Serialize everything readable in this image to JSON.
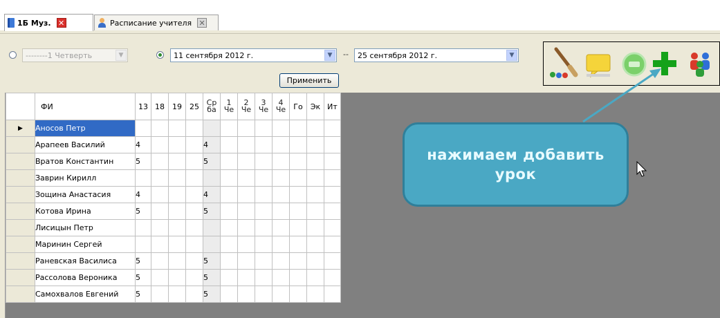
{
  "tabs": [
    {
      "label": "1Б Муз.",
      "active": true,
      "icon": "book-icon",
      "close": "close-red-icon"
    },
    {
      "label": "Расписание учителя",
      "active": false,
      "icon": "person-icon",
      "close": "close-grey-icon"
    }
  ],
  "filter": {
    "quarter_value": "--------1 Четверть",
    "date_from": "11 сентября 2012 г.",
    "date_sep": "--",
    "date_to": "25 сентября 2012 г.",
    "apply_label": "Применить"
  },
  "toolbar": {
    "tools": [
      "paint-brush-icon",
      "comment-icon",
      "lesson-plan-icon",
      "add-lesson-icon",
      "group-users-icon"
    ]
  },
  "grid": {
    "headers": {
      "name": "ФИ",
      "dates": [
        "13",
        "18",
        "19",
        "25"
      ],
      "avg": [
        "Ср",
        "ба"
      ],
      "quarters": [
        [
          "1",
          "Че"
        ],
        [
          "2",
          "Че"
        ],
        [
          "3",
          "Че"
        ],
        [
          "4",
          "Че"
        ]
      ],
      "extra": [
        "Го",
        "Эк",
        "Ит"
      ]
    },
    "rows": [
      {
        "name": "Аносов Петр",
        "g13": "",
        "avg": "",
        "selected": true
      },
      {
        "name": "Арапеев Василий",
        "g13": "4",
        "avg": "4"
      },
      {
        "name": "Вратов Константин",
        "g13": "5",
        "avg": "5"
      },
      {
        "name": "Заврин Кирилл",
        "g13": "",
        "avg": ""
      },
      {
        "name": "Зощина Анастасия",
        "g13": "4",
        "avg": "4"
      },
      {
        "name": "Котова Ирина",
        "g13": "5",
        "avg": "5"
      },
      {
        "name": "Лисицын Петр",
        "g13": "",
        "avg": ""
      },
      {
        "name": "Маринин Сергей",
        "g13": "",
        "avg": ""
      },
      {
        "name": "Раневская Василиса",
        "g13": "5",
        "avg": "5"
      },
      {
        "name": "Рассолова Вероника",
        "g13": "5",
        "avg": "5"
      },
      {
        "name": "Самохвалов Евгений",
        "g13": "5",
        "avg": "5"
      }
    ],
    "current_row_marker": "▶"
  },
  "callout": {
    "line1": "нажимаем добавить",
    "line2": "урок",
    "bg": "#4aa8c4"
  }
}
